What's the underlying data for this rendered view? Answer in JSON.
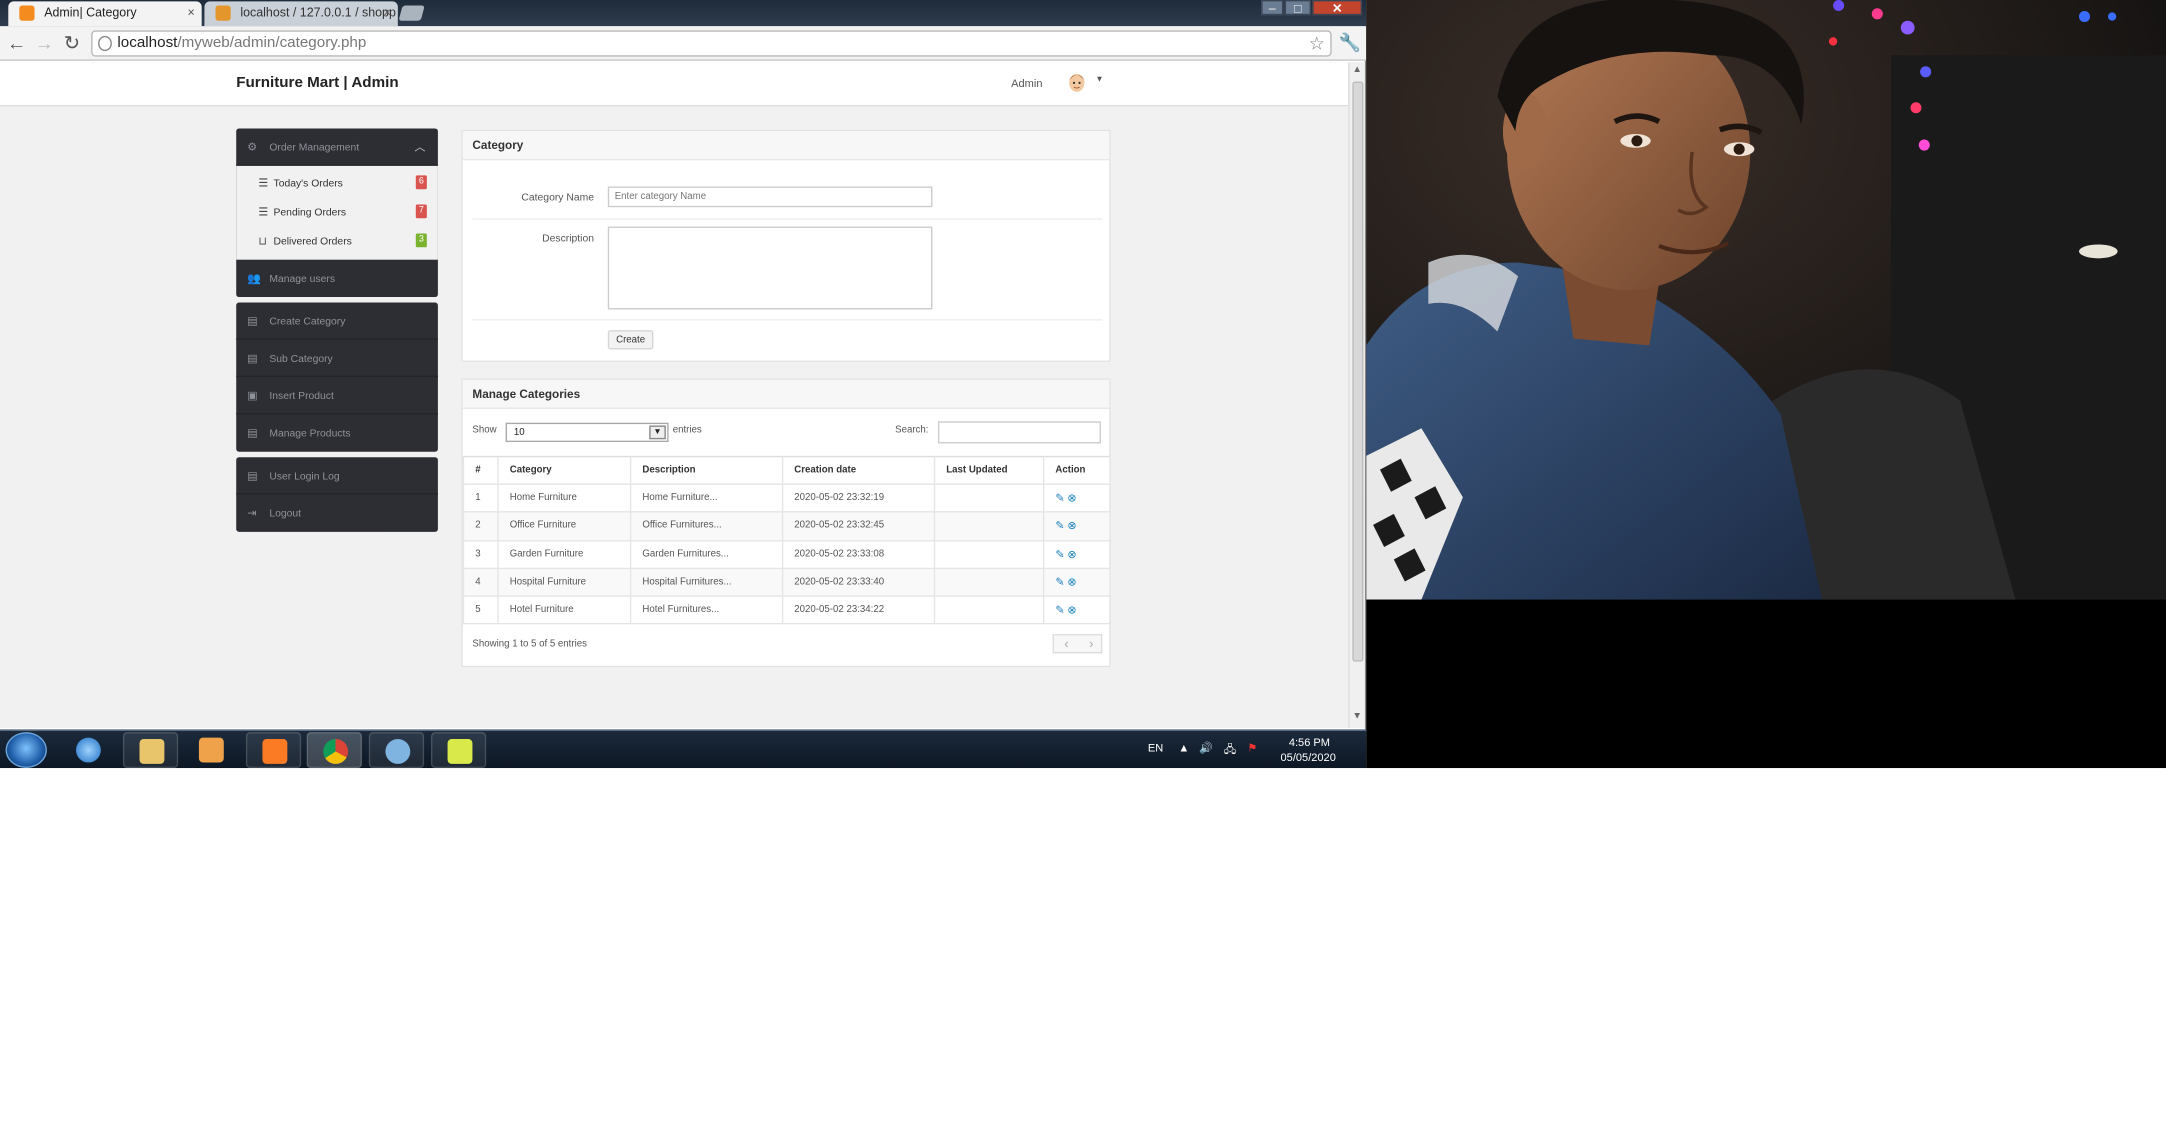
{
  "browser": {
    "tabs": [
      {
        "title": "Admin| Category",
        "active": true
      },
      {
        "title": "localhost / 127.0.0.1 / shopp",
        "active": false
      }
    ],
    "window_controls": {
      "minimize": "–",
      "maximize": "□",
      "close": "✕"
    },
    "url_host": "localhost",
    "url_path": "/myweb/admin/category.php"
  },
  "navbar": {
    "brand": "Furniture Mart | Admin",
    "user": "Admin"
  },
  "sidebar": {
    "order_management": "Order Management",
    "sub_items": [
      {
        "label": "Today's Orders",
        "badge": "6",
        "badge_color": "#d9534f"
      },
      {
        "label": "Pending Orders",
        "badge": "7",
        "badge_color": "#d9534f"
      },
      {
        "label": "Delivered Orders",
        "badge": "3",
        "badge_color": "#5cb85c"
      }
    ],
    "manage_users": "Manage users",
    "create_category": "Create Category",
    "sub_category": "Sub Category",
    "insert_product": "Insert Product",
    "manage_products": "Manage Products",
    "user_login_log": "User Login Log",
    "logout": "Logout"
  },
  "category_form": {
    "title": "Category",
    "name_label": "Category Name",
    "name_placeholder": "Enter category Name",
    "description_label": "Description",
    "create_button": "Create"
  },
  "manage": {
    "title": "Manage Categories",
    "show_label": "Show",
    "entries_value": "10",
    "entries_label": "entries",
    "search_label": "Search:",
    "columns": [
      "#",
      "Category",
      "Description",
      "Creation date",
      "Last Updated",
      "Action"
    ],
    "rows": [
      {
        "num": "1",
        "category": "Home Furniture",
        "description": "Home Furniture...",
        "created": "2020-05-02 23:32:19",
        "updated": ""
      },
      {
        "num": "2",
        "category": "Office Furniture",
        "description": "Office Furnitures...",
        "created": "2020-05-02 23:32:45",
        "updated": ""
      },
      {
        "num": "3",
        "category": "Garden Furniture",
        "description": "Garden Furnitures...",
        "created": "2020-05-02 23:33:08",
        "updated": ""
      },
      {
        "num": "4",
        "category": "Hospital Furniture",
        "description": "Hospital Furnitures...",
        "created": "2020-05-02 23:33:40",
        "updated": ""
      },
      {
        "num": "5",
        "category": "Hotel Furniture",
        "description": "Hotel Furnitures...",
        "created": "2020-05-02 23:34:22",
        "updated": ""
      }
    ],
    "summary": "Showing 1 to 5 of 5 entries"
  },
  "taskbar": {
    "lang": "EN",
    "time": "4:56 PM",
    "date": "05/05/2020"
  },
  "colors": {
    "sidebar_bg": "#2d2d34",
    "page_bg": "#f1f1f1",
    "action_icon": "#1b7fbd"
  }
}
